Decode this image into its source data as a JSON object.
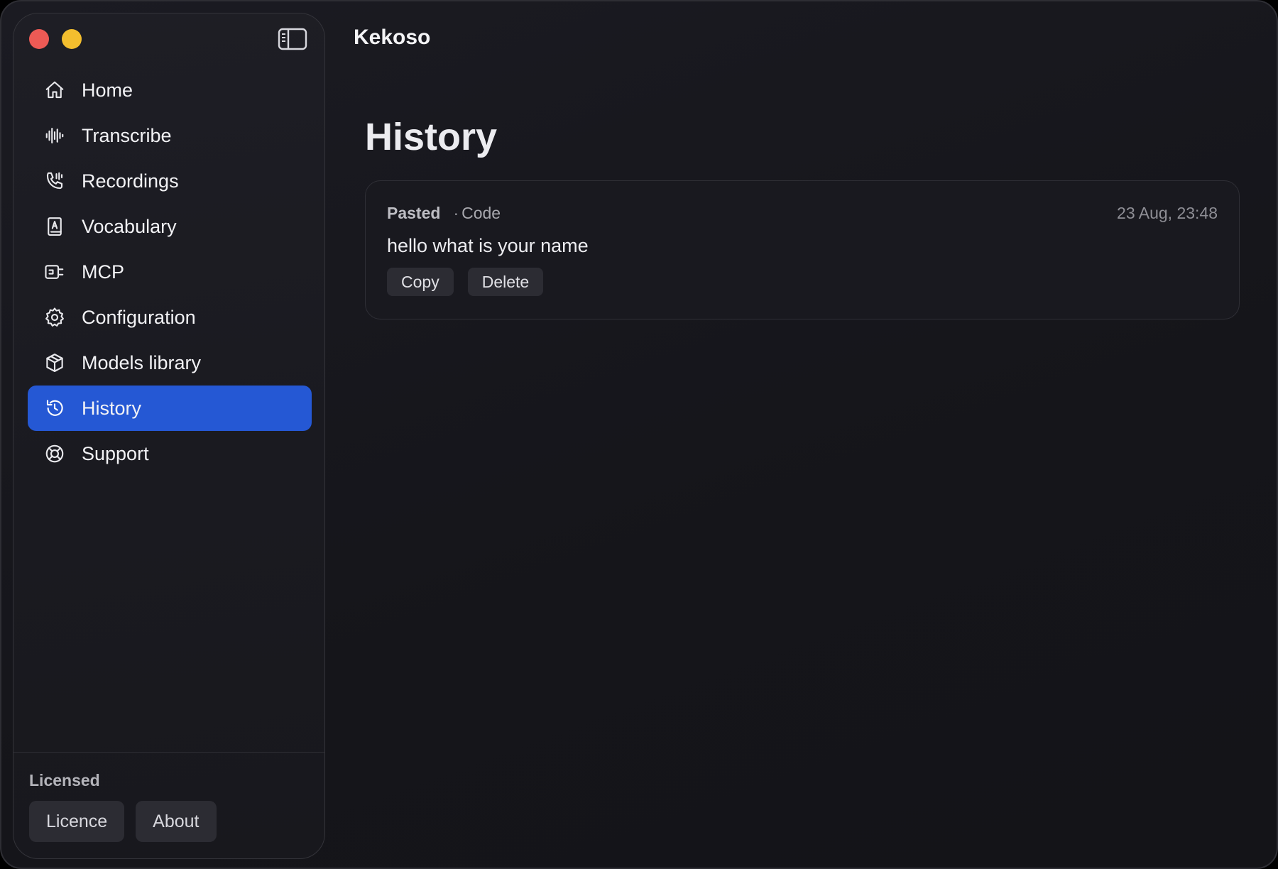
{
  "window": {
    "traffic_lights": [
      {
        "name": "close",
        "color": "#ed5a55"
      },
      {
        "name": "minimize",
        "color": "#f3be2e"
      }
    ],
    "sidebar_toggle_icon": "sidebar-toggle-icon"
  },
  "app": {
    "title": "Kekoso"
  },
  "sidebar": {
    "active_color": "#2558d4",
    "items": [
      {
        "label": "Home",
        "icon": "home-icon",
        "active": false
      },
      {
        "label": "Transcribe",
        "icon": "waveform-icon",
        "active": false
      },
      {
        "label": "Recordings",
        "icon": "phone-wave-icon",
        "active": false
      },
      {
        "label": "Vocabulary",
        "icon": "dictionary-icon",
        "active": false
      },
      {
        "label": "MCP",
        "icon": "plug-icon",
        "active": false
      },
      {
        "label": "Configuration",
        "icon": "gear-icon",
        "active": false
      },
      {
        "label": "Models library",
        "icon": "cube-icon",
        "active": false
      },
      {
        "label": "History",
        "icon": "history-icon",
        "active": true
      },
      {
        "label": "Support",
        "icon": "lifebuoy-icon",
        "active": false
      }
    ],
    "footer": {
      "status": "Licensed",
      "licence_label": "Licence",
      "about_label": "About"
    }
  },
  "main": {
    "page_title": "History",
    "entries": [
      {
        "status": "Pasted",
        "separator": "·",
        "source": "Code",
        "timestamp": "23 Aug, 23:48",
        "text": "hello what is your name",
        "copy_label": "Copy",
        "delete_label": "Delete"
      }
    ]
  }
}
